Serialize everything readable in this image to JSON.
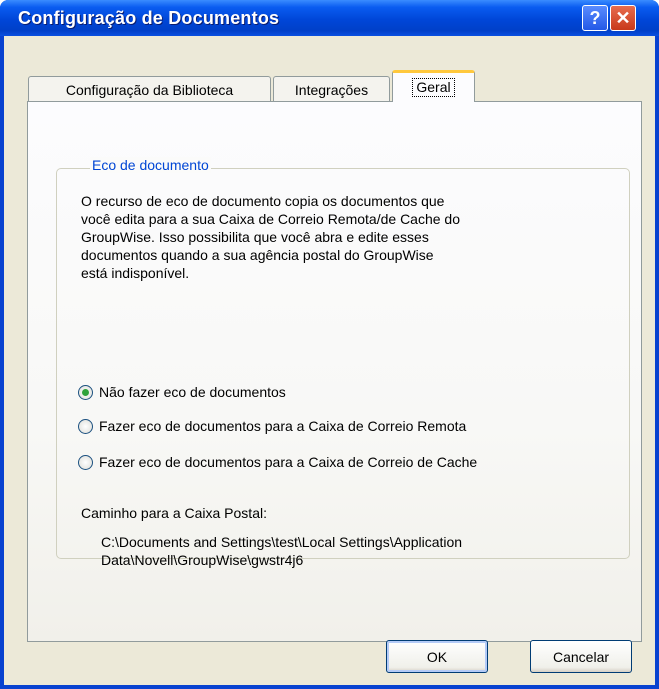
{
  "window": {
    "title": "Configuração de Documentos",
    "help_label": "?",
    "close_label": "✕"
  },
  "tabs": [
    {
      "label": "Configuração da Biblioteca",
      "selected": false
    },
    {
      "label": "Integrações",
      "selected": false
    },
    {
      "label": "Geral",
      "selected": true
    }
  ],
  "group": {
    "legend": "Eco de documento",
    "description_lines": [
      "O recurso de eco de documento copia os documentos que",
      "você edita para a sua Caixa de Correio Remota/de Cache do",
      "GroupWise. Isso possibilita que você abra e edite esses",
      "documentos quando a sua agência postal do GroupWise",
      "está indisponível."
    ],
    "options": [
      {
        "label": "Não fazer eco de documentos",
        "checked": true
      },
      {
        "label": "Fazer eco de documentos para a Caixa de Correio Remota",
        "checked": false
      },
      {
        "label": "Fazer eco de documentos para a Caixa de Correio de Cache",
        "checked": false
      }
    ],
    "path_label": "Caminho para a Caixa Postal:",
    "path_lines": [
      "C:\\Documents and Settings\\test\\Local Settings\\Application",
      "Data\\Novell\\GroupWise\\gwstr4j6"
    ]
  },
  "buttons": {
    "ok": "OK",
    "cancel": "Cancelar"
  },
  "colors": {
    "title_bar": "#0046d8",
    "legend_text": "#0046d5",
    "dialog_bg": "#ece9d8",
    "selected_tab_accent": "#ffc83c"
  }
}
